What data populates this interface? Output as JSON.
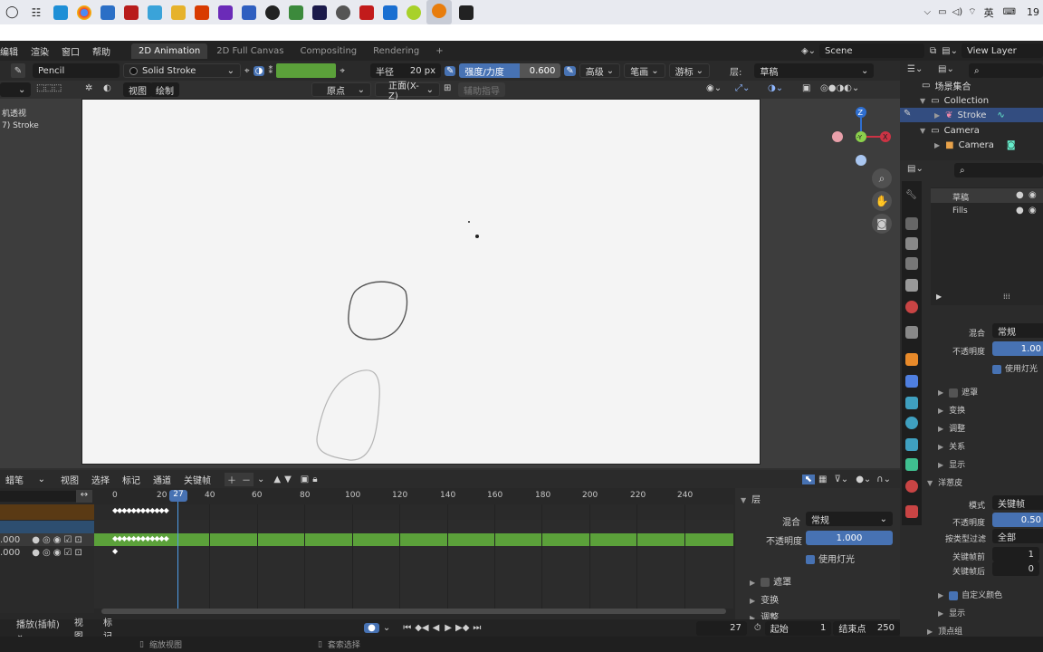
{
  "taskbar": {
    "time": "19",
    "lang": "英",
    "icons": [
      "windows-start-icon",
      "task-view-icon",
      "edge-icon",
      "chrome-icon",
      "mail-icon",
      "game-icon",
      "photos-icon",
      "explorer-icon",
      "office-icon",
      "jetbrains-icon",
      "premiere-mini-icon",
      "qq-icon",
      "green-app-icon",
      "premiere-icon",
      "media-icon",
      "acrobat-icon",
      "star-icon",
      "tennis-icon",
      "blender-icon",
      "davinci-icon"
    ]
  },
  "menubar": {
    "menus": [
      "编辑",
      "渲染",
      "窗口",
      "帮助"
    ],
    "tabs": [
      "2D Animation",
      "2D Full Canvas",
      "Compositing",
      "Rendering"
    ],
    "add_tab": "+",
    "scene": "Scene",
    "view_layer": "View Layer"
  },
  "toolheader": {
    "brush": "Pencil",
    "material": "Solid Stroke",
    "radius_label": "半径",
    "radius_value": "20 px",
    "strength_label": "强度/力度",
    "strength_value": "0.600",
    "advanced": "高级",
    "stroke": "笔画",
    "cursor": "游标",
    "layer_label": "层:",
    "layer_value": "草稿"
  },
  "viewport_header": {
    "view": "视图",
    "draw": "绘制",
    "origin": "原点",
    "front": "正面(X-Z)",
    "guides": "辅助指导"
  },
  "viewport_overlay": {
    "line1": "机透视",
    "line2": "7) Stroke"
  },
  "gizmo": {
    "z": "Z",
    "y": "-Y",
    "x": "X"
  },
  "dopesheet": {
    "mode": "蜡笔",
    "menus": [
      "视图",
      "选择",
      "标记",
      "通道",
      "关键帧"
    ],
    "current_frame": "27",
    "frame_ticks": [
      "0",
      "20",
      "40",
      "60",
      "80",
      "100",
      "120",
      "140",
      "160",
      "180",
      "200",
      "220",
      "240"
    ],
    "channels": [
      {
        "value": ".000"
      },
      {
        "value": ".000"
      }
    ]
  },
  "dope_side": {
    "title": "层",
    "blend_label": "混合",
    "blend_value": "常规",
    "opacity_label": "不透明度",
    "opacity_value": "1.000",
    "use_lights": "使用灯光",
    "mask": "遮罩",
    "transform": "变换",
    "adjust": "调整"
  },
  "playbar": {
    "playback": "播放(插帧)",
    "view": "视图",
    "marker": "标记",
    "frame": "27",
    "start_label": "起始",
    "start_value": "1",
    "end_label": "结束点",
    "end_value": "250"
  },
  "statusbar": {
    "left": "缩放视图",
    "right": "套索选择"
  },
  "outliner": {
    "root": "场景集合",
    "collection": "Collection",
    "stroke": "Stroke",
    "camera_parent": "Camera",
    "camera": "Camera"
  },
  "properties": {
    "layers": [
      "草稿",
      "Fills"
    ],
    "blend_label": "混合",
    "blend_value": "常规",
    "opacity_label": "不透明度",
    "opacity_value": "1.00",
    "use_lights": "使用灯光",
    "mask": "遮罩",
    "transform": "变换",
    "adjust": "调整",
    "relations": "关系",
    "display": "显示",
    "onion_title": "洋葱皮",
    "mode_label": "模式",
    "mode_value": "关键帧",
    "onion_opacity_label": "不透明度",
    "onion_opacity_value": "0.50",
    "filter_label": "按类型过滤",
    "filter_value": "全部",
    "before_label": "关键帧前",
    "before_value": "1",
    "after_label": "关键帧后",
    "after_value": "0",
    "custom_color": "自定义颜色",
    "display2": "显示",
    "vertex_group": "顶点组"
  },
  "colors": {
    "accent_blue": "#4772b3",
    "track_green": "#5ba13a",
    "orange_channel": "#5a3a14"
  }
}
